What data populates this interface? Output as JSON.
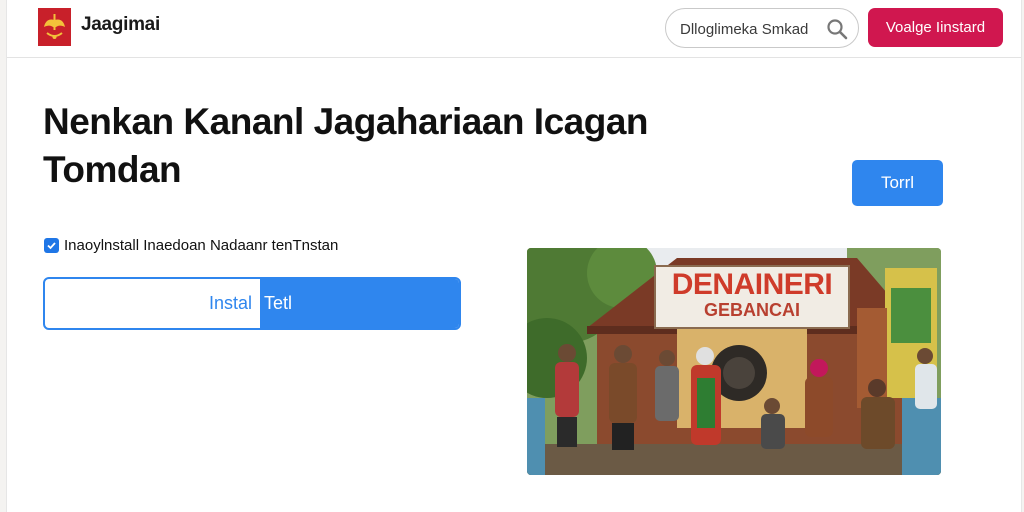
{
  "header": {
    "brand": "Jaagimai",
    "search_placeholder": "Dlloglimeka Smkad",
    "install_label": "Voalge Iinstard"
  },
  "hero": {
    "title": "Nenkan Kananl Jagahariaan Icagan Tomdan",
    "side_button": "Torrl",
    "checkbox_label": "Inaoylnstall Inaedoan Nadaanr tenTnstan",
    "checkbox_checked": true,
    "field_left_label": "Instal",
    "field_right_label": "Tetl"
  },
  "photo": {
    "sign_title": "DENAINERI",
    "sign_subtitle": "GEBANCAI"
  },
  "colors": {
    "brand_red": "#c8202a",
    "install_pink": "#d0174f",
    "accent_blue": "#2f86ee"
  },
  "icons": [
    "logo-emblem-icon",
    "search-icon",
    "check-icon"
  ]
}
